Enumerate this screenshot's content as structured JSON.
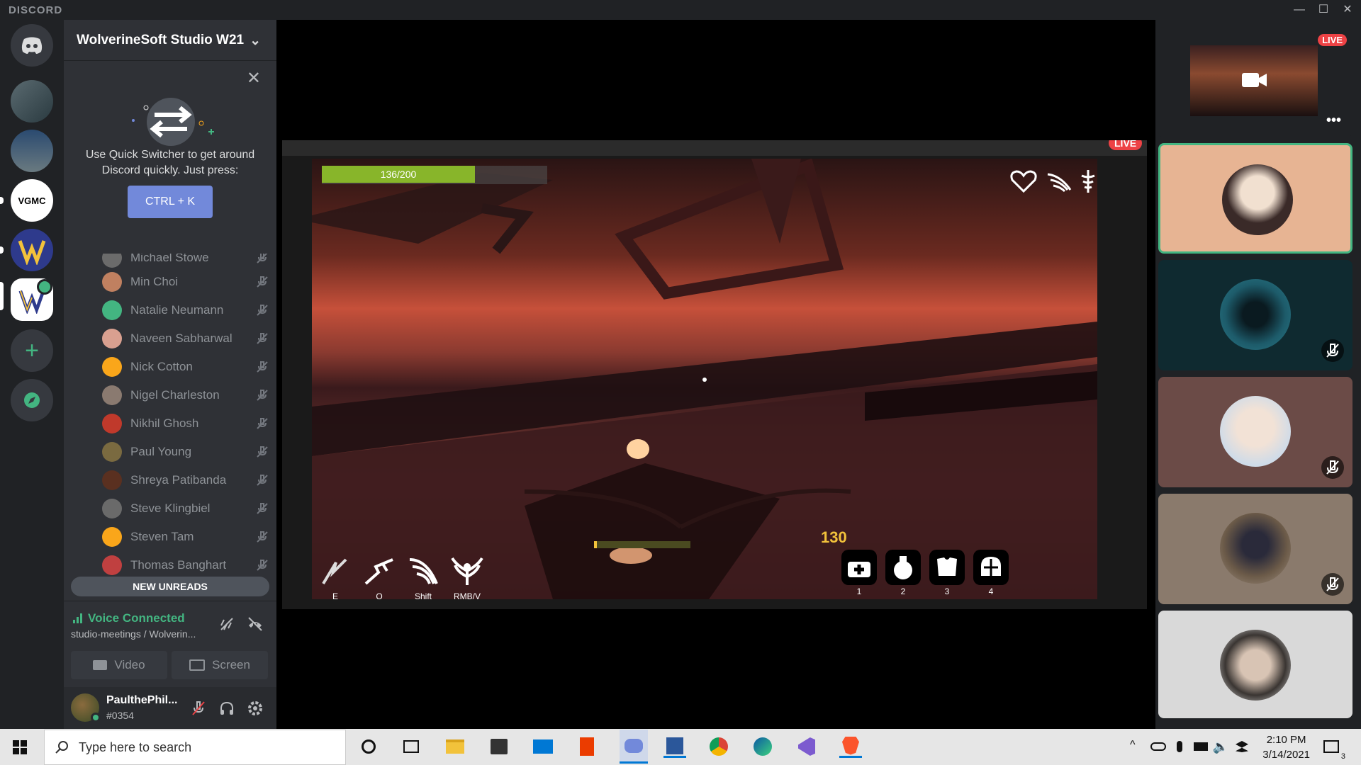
{
  "app": {
    "brand": "DISCORD"
  },
  "window_controls": {
    "minimize": "—",
    "maximize": "☐",
    "close": "✕"
  },
  "servers": [
    {
      "name": "home",
      "label": ""
    },
    {
      "name": "server-1",
      "label": ""
    },
    {
      "name": "server-2",
      "label": ""
    },
    {
      "name": "vgmc",
      "label": "VGMC"
    },
    {
      "name": "wolverinesoft",
      "label": ""
    },
    {
      "name": "wolverinesoft-studio",
      "label": ""
    }
  ],
  "guild": {
    "name": "WolverineSoft Studio W21"
  },
  "quick_switcher": {
    "message": "Use Quick Switcher to get around Discord quickly. Just press:",
    "shortcut": "CTRL + K"
  },
  "members": [
    {
      "name": "Michael Stowe",
      "color": "#6b6b6b"
    },
    {
      "name": "Min Choi",
      "color": "#c08060"
    },
    {
      "name": "Natalie Neumann",
      "color": "#43b581"
    },
    {
      "name": "Naveen Sabharwal",
      "color": "#d9a090"
    },
    {
      "name": "Nick Cotton",
      "color": "#faa61a"
    },
    {
      "name": "Nigel Charleston",
      "color": "#8a7a70"
    },
    {
      "name": "Nikhil Ghosh",
      "color": "#c0392b"
    },
    {
      "name": "Paul Young",
      "color": "#7a6a40"
    },
    {
      "name": "Shreya Patibanda",
      "color": "#5a3020"
    },
    {
      "name": "Steve Klingbiel",
      "color": "#6a6a6a"
    },
    {
      "name": "Steven Tam",
      "color": "#faa61a"
    },
    {
      "name": "Thomas Banghart",
      "color": "#c04040"
    }
  ],
  "new_unreads": "NEW UNREADS",
  "voice": {
    "status": "Voice Connected",
    "channel": "studio-meetings / Wolverin...",
    "video_label": "Video",
    "screen_label": "Screen"
  },
  "user": {
    "name": "PaulthePhil...",
    "tag": "#0354"
  },
  "stream": {
    "live": "LIVE",
    "hp_text": "136/200",
    "hp_fraction": 0.68,
    "ammo": "130",
    "abilities": [
      {
        "key": "E",
        "icon": "slash-icon"
      },
      {
        "key": "Q",
        "icon": "dash-icon"
      },
      {
        "key": "Shift",
        "icon": "wing-icon"
      },
      {
        "key": "RMB/V",
        "icon": "wings-icon"
      }
    ],
    "items": [
      {
        "key": "1",
        "icon": "medkit-icon"
      },
      {
        "key": "2",
        "icon": "potion-icon"
      },
      {
        "key": "3",
        "icon": "armor-icon"
      },
      {
        "key": "4",
        "icon": "helmet-icon"
      }
    ]
  },
  "tiles": [
    {
      "name": "stream-preview",
      "live": "LIVE",
      "bg": "#202225"
    },
    {
      "name": "participant-1",
      "bg": "#e7b493",
      "face": "#3a2a28",
      "speaking": true
    },
    {
      "name": "participant-2",
      "bg": "#0f2a30",
      "face": "#1d5b6a",
      "muted": true
    },
    {
      "name": "participant-3",
      "bg": "#6b4b47",
      "face": "#e8d7cc",
      "muted": true
    },
    {
      "name": "participant-4",
      "bg": "#8a7a6c",
      "face": "#6b5a48",
      "muted": true
    },
    {
      "name": "participant-5",
      "bg": "#d9d9d9",
      "face": "#3a3532"
    }
  ],
  "taskbar": {
    "search_placeholder": "Type here to search",
    "time": "2:10 PM",
    "date": "3/14/2021",
    "notifications": "3"
  }
}
